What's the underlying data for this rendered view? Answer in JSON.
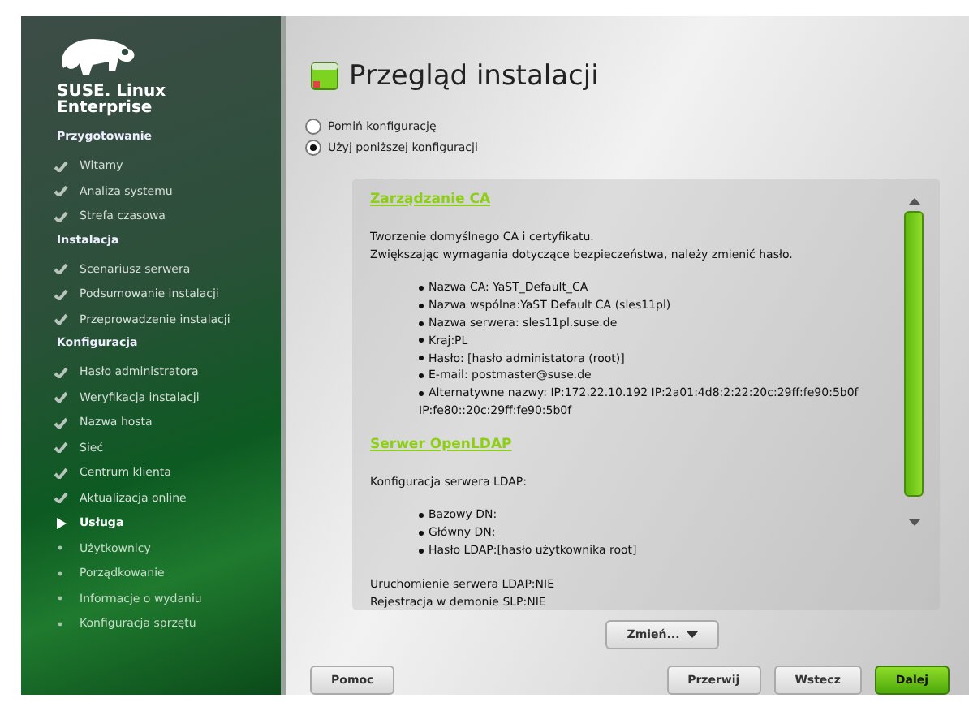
{
  "sidebar": {
    "brand": [
      "SUSE. Linux",
      "Enterprise"
    ],
    "sections": [
      {
        "heading": "Przygotowanie",
        "steps": [
          {
            "label": "Witamy",
            "kind": "done"
          },
          {
            "label": "Analiza systemu",
            "kind": "done"
          },
          {
            "label": "Strefa czasowa",
            "kind": "done"
          }
        ]
      },
      {
        "heading": "Instalacja",
        "steps": [
          {
            "label": "Scenariusz serwera",
            "kind": "done"
          },
          {
            "label": "Podsumowanie instalacji",
            "kind": "done"
          },
          {
            "label": "Przeprowadzenie instalacji",
            "kind": "done"
          }
        ]
      },
      {
        "heading": "Konfiguracja",
        "steps": [
          {
            "label": "Hasło administratora",
            "kind": "done"
          },
          {
            "label": "Weryfikacja instalacji",
            "kind": "done"
          },
          {
            "label": "Nazwa hosta",
            "kind": "done"
          },
          {
            "label": "Sieć",
            "kind": "done"
          },
          {
            "label": "Centrum klienta",
            "kind": "done"
          },
          {
            "label": "Aktualizacja online",
            "kind": "done"
          },
          {
            "label": "Usługa",
            "kind": "current"
          },
          {
            "label": "Użytkownicy",
            "kind": "pending"
          },
          {
            "label": "Porządkowanie",
            "kind": "pending"
          },
          {
            "label": "Informacje o wydaniu",
            "kind": "pending"
          },
          {
            "label": "Konfiguracja sprzętu",
            "kind": "pending"
          }
        ]
      }
    ]
  },
  "title": "Przegląd instalacji",
  "options": [
    {
      "label": "Pomiń konfigurację",
      "selected": false
    },
    {
      "label": "Użyj poniższej konfiguracji",
      "selected": true
    }
  ],
  "summary": [
    {
      "kind": "heading",
      "text": "Zarządzanie CA"
    },
    {
      "kind": "para",
      "lines": [
        "Tworzenie domyślnego CA i certyfikatu.",
        "Zwiększając wymagania dotyczące bezpieczeństwa, należy zmienić hasło."
      ]
    },
    {
      "kind": "list",
      "items": [
        "Nazwa CA: YaST_Default_CA",
        "Nazwa wspólna:YaST Default CA (sles11pl)",
        "Nazwa serwera: sles11pl.suse.de",
        "Kraj:PL",
        "Hasło: [hasło administatora (root)]",
        "E-mail: postmaster@suse.de",
        "Alternatywne nazwy: IP:172.22.10.192 IP:2a01:4d8:2:22:20c:29ff:fe90:5b0f IP:fe80::20c:29ff:fe90:5b0f"
      ]
    },
    {
      "kind": "heading",
      "text": "Serwer OpenLDAP"
    },
    {
      "kind": "para",
      "lines": [
        "Konfiguracja serwera LDAP:"
      ]
    },
    {
      "kind": "list",
      "items": [
        "Bazowy DN:",
        "Główny DN:",
        "Hasło LDAP:[hasło użytkownika root]"
      ]
    },
    {
      "kind": "para",
      "lines": [
        "Uruchomienie serwera LDAP:NIE",
        "Rejestracja w demonie SLP:NIE"
      ]
    }
  ],
  "change_button": "Zmień...",
  "help_button": "Pomoc",
  "nav_buttons": [
    {
      "label": "Przerwij",
      "kind": "plain"
    },
    {
      "label": "Wstecz",
      "kind": "plain"
    },
    {
      "label": "Dalej",
      "kind": "primary"
    }
  ]
}
